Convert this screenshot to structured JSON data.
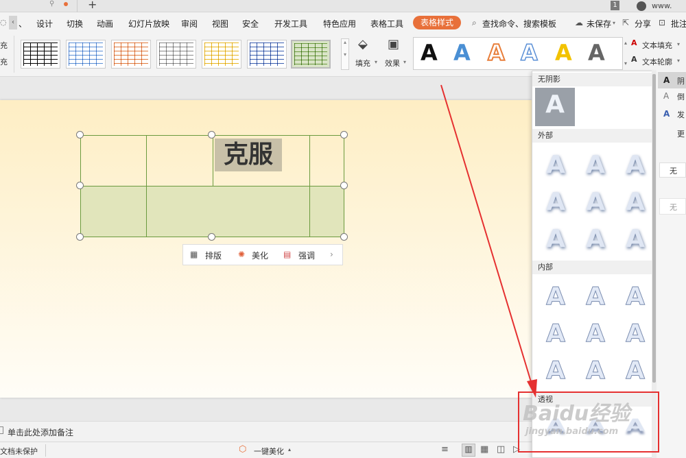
{
  "menu": {
    "items": [
      "设计",
      "切换",
      "动画",
      "幻灯片放映",
      "审阅",
      "视图",
      "安全",
      "开发工具",
      "特色应用",
      "表格工具"
    ],
    "active_tab": "表格样式",
    "search": "查找命令、搜索模板",
    "unsaved": "未保存",
    "share": "分享",
    "comment": "批注"
  },
  "titlebar": {
    "new_tab": "+",
    "badge": "1",
    "user": "www."
  },
  "ribbon": {
    "left_labels": [
      "充",
      "充"
    ],
    "fill": "填充",
    "effect": "效果",
    "text_fill": "文本填充",
    "text_outline": "文本轮廓",
    "text_glyph": "A"
  },
  "slide": {
    "title_text": "克服"
  },
  "floatbar": {
    "layout": "排版",
    "beautify": "美化",
    "emphasize": "强调"
  },
  "shadow_menu": {
    "no_shadow_header": "无阴影",
    "outer_header": "外部",
    "inner_header": "内部",
    "perspective_header": "透视",
    "glyph": "A"
  },
  "right_panel": {
    "items": [
      "阴",
      "倒",
      "发",
      "更"
    ],
    "none1": "无",
    "none2": "无",
    "glyph": "A"
  },
  "notes": {
    "placeholder": "单击此处添加备注"
  },
  "status": {
    "protection": "文档未保护",
    "beautify": "一键美化"
  },
  "watermark": {
    "line1": "Baidu经验",
    "line2": "jingyan.baidu.com"
  },
  "colors": {
    "accent": "#e8703a",
    "highlight_box": "#e53030",
    "table_border": "#6a9a3d"
  }
}
